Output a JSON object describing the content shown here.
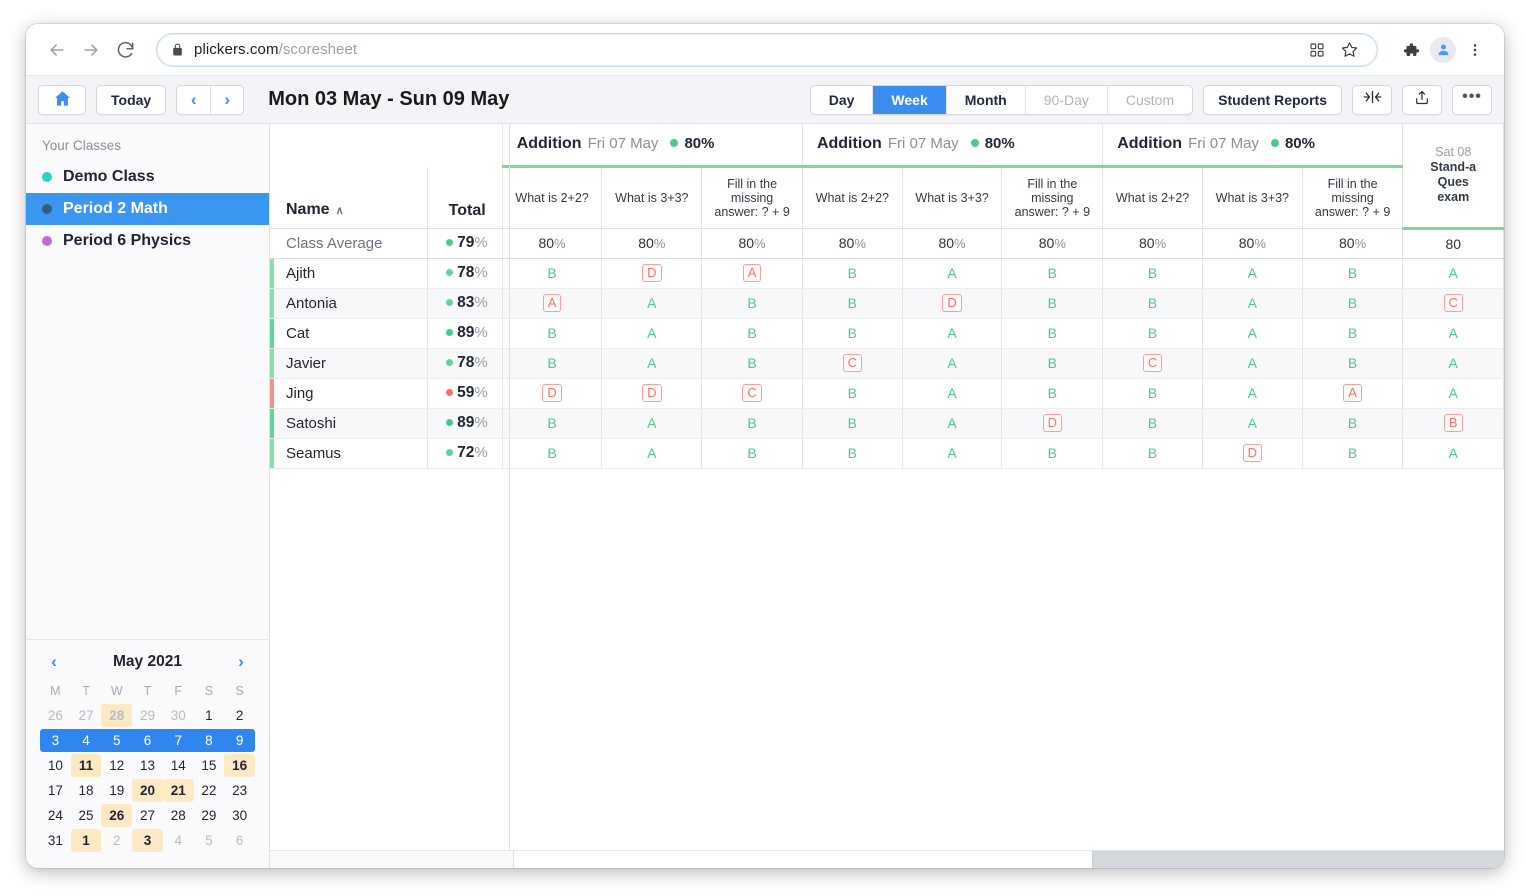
{
  "browser": {
    "url_domain": "plickers.com",
    "url_path": "/scoresheet",
    "back_icon": "back-arrow-icon",
    "forward_icon": "forward-arrow-icon",
    "reload_icon": "reload-icon",
    "lock_icon": "lock-icon",
    "qr_icon": "qr-code-icon",
    "star_icon": "star-icon",
    "extensions_icon": "puzzle-icon",
    "profile_icon": "profile-avatar-icon",
    "menu_icon": "three-dot-menu-icon"
  },
  "toolbar": {
    "home_label": "Home",
    "today_label": "Today",
    "prev_label": "‹",
    "next_label": "›",
    "date_range": "Mon 03 May - Sun 09 May",
    "ranges": [
      {
        "label": "Day",
        "state": "normal"
      },
      {
        "label": "Week",
        "state": "active"
      },
      {
        "label": "Month",
        "state": "normal"
      },
      {
        "label": "90-Day",
        "state": "disabled"
      },
      {
        "label": "Custom",
        "state": "disabled"
      }
    ],
    "student_reports_label": "Student Reports",
    "collapse_icon": "collapse-columns-icon",
    "export_icon": "export-upload-icon",
    "more_label": "•••"
  },
  "sidebar": {
    "title": "Your Classes",
    "items": [
      {
        "label": "Demo Class",
        "color": "#2ecfc3",
        "selected": false
      },
      {
        "label": "Period 2 Math",
        "color": "#2d5f7f",
        "selected": true
      },
      {
        "label": "Period 6 Physics",
        "color": "#bb6fd6",
        "selected": false
      }
    ]
  },
  "calendar": {
    "prev_label": "‹",
    "next_label": "›",
    "month_label": "May 2021",
    "dow": [
      "M",
      "T",
      "W",
      "T",
      "F",
      "S",
      "S"
    ],
    "weeks": [
      {
        "selected": false,
        "days": [
          {
            "n": "26",
            "muted": true,
            "hl": false
          },
          {
            "n": "27",
            "muted": true,
            "hl": false
          },
          {
            "n": "28",
            "muted": true,
            "hl": true
          },
          {
            "n": "29",
            "muted": true,
            "hl": false
          },
          {
            "n": "30",
            "muted": true,
            "hl": false
          },
          {
            "n": "1",
            "muted": false,
            "hl": false
          },
          {
            "n": "2",
            "muted": false,
            "hl": false
          }
        ]
      },
      {
        "selected": true,
        "days": [
          {
            "n": "3",
            "muted": false,
            "hl": false
          },
          {
            "n": "4",
            "muted": false,
            "hl": false
          },
          {
            "n": "5",
            "muted": false,
            "hl": false
          },
          {
            "n": "6",
            "muted": false,
            "hl": false
          },
          {
            "n": "7",
            "muted": false,
            "hl": false
          },
          {
            "n": "8",
            "muted": false,
            "hl": false
          },
          {
            "n": "9",
            "muted": false,
            "hl": false
          }
        ]
      },
      {
        "selected": false,
        "days": [
          {
            "n": "10",
            "muted": false,
            "hl": false
          },
          {
            "n": "11",
            "muted": false,
            "hl": true
          },
          {
            "n": "12",
            "muted": false,
            "hl": false
          },
          {
            "n": "13",
            "muted": false,
            "hl": false
          },
          {
            "n": "14",
            "muted": false,
            "hl": false
          },
          {
            "n": "15",
            "muted": false,
            "hl": false
          },
          {
            "n": "16",
            "muted": false,
            "hl": true
          }
        ]
      },
      {
        "selected": false,
        "days": [
          {
            "n": "17",
            "muted": false,
            "hl": false
          },
          {
            "n": "18",
            "muted": false,
            "hl": false
          },
          {
            "n": "19",
            "muted": false,
            "hl": false
          },
          {
            "n": "20",
            "muted": false,
            "hl": true
          },
          {
            "n": "21",
            "muted": false,
            "hl": true
          },
          {
            "n": "22",
            "muted": false,
            "hl": false
          },
          {
            "n": "23",
            "muted": false,
            "hl": false
          }
        ]
      },
      {
        "selected": false,
        "days": [
          {
            "n": "24",
            "muted": false,
            "hl": false
          },
          {
            "n": "25",
            "muted": false,
            "hl": false
          },
          {
            "n": "26",
            "muted": false,
            "hl": true
          },
          {
            "n": "27",
            "muted": false,
            "hl": false
          },
          {
            "n": "28",
            "muted": false,
            "hl": false
          },
          {
            "n": "29",
            "muted": false,
            "hl": false
          },
          {
            "n": "30",
            "muted": false,
            "hl": false
          }
        ]
      },
      {
        "selected": false,
        "days": [
          {
            "n": "31",
            "muted": false,
            "hl": false
          },
          {
            "n": "1",
            "muted": false,
            "hl": true
          },
          {
            "n": "2",
            "muted": true,
            "hl": false
          },
          {
            "n": "3",
            "muted": false,
            "hl": true
          },
          {
            "n": "4",
            "muted": true,
            "hl": false
          },
          {
            "n": "5",
            "muted": true,
            "hl": false
          },
          {
            "n": "6",
            "muted": true,
            "hl": false
          }
        ]
      }
    ]
  },
  "scoresheet": {
    "name_header": "Name",
    "sort_caret": "∧",
    "total_header": "Total",
    "sets": [
      {
        "name": "Addition",
        "date": "Fri 07 May",
        "pct": "80%",
        "dot_color": "#4cc98a",
        "questions": [
          "What is 2+2?",
          "What is 3+3?",
          "Fill in the missing answer: ? + 9"
        ]
      },
      {
        "name": "Addition",
        "date": "Fri 07 May",
        "pct": "80%",
        "dot_color": "#4cc98a",
        "questions": [
          "What is 2+2?",
          "What is 3+3?",
          "Fill in the missing answer: ? + 9"
        ]
      },
      {
        "name": "Addition",
        "date": "Fri 07 May",
        "pct": "80%",
        "dot_color": "#4cc98a",
        "questions": [
          "What is 2+2?",
          "What is 3+3?",
          "Fill in the missing answer: ? + 9"
        ]
      }
    ],
    "standalone": {
      "date": "Sat 08",
      "line1": "Stand-a",
      "line2": "Ques",
      "line3": "exam"
    },
    "average_row": {
      "name": "Class Average",
      "total": "79",
      "total_symbol": "%",
      "dot_color": "#4cc98a",
      "cells": [
        "80%",
        "80%",
        "80%",
        "80%",
        "80%",
        "80%",
        "80%",
        "80%",
        "80%",
        "80"
      ]
    },
    "rows": [
      {
        "name": "Ajith",
        "total": "78",
        "dot_color": "#5ed39b",
        "flag_color": "#86dfae",
        "answers": [
          {
            "v": "B",
            "correct": true
          },
          {
            "v": "D",
            "correct": false
          },
          {
            "v": "A",
            "correct": false
          },
          {
            "v": "B",
            "correct": true
          },
          {
            "v": "A",
            "correct": true
          },
          {
            "v": "B",
            "correct": true
          },
          {
            "v": "B",
            "correct": true
          },
          {
            "v": "A",
            "correct": true
          },
          {
            "v": "B",
            "correct": true
          },
          {
            "v": "A",
            "correct": true
          }
        ]
      },
      {
        "name": "Antonia",
        "total": "83",
        "dot_color": "#5ed39b",
        "flag_color": "#86dfae",
        "answers": [
          {
            "v": "A",
            "correct": false
          },
          {
            "v": "A",
            "correct": true
          },
          {
            "v": "B",
            "correct": true
          },
          {
            "v": "B",
            "correct": true
          },
          {
            "v": "D",
            "correct": false
          },
          {
            "v": "B",
            "correct": true
          },
          {
            "v": "B",
            "correct": true
          },
          {
            "v": "A",
            "correct": true
          },
          {
            "v": "B",
            "correct": true
          },
          {
            "v": "C",
            "correct": false
          }
        ]
      },
      {
        "name": "Cat",
        "total": "89",
        "dot_color": "#3ecb8d",
        "flag_color": "#5cd79e",
        "answers": [
          {
            "v": "B",
            "correct": true
          },
          {
            "v": "A",
            "correct": true
          },
          {
            "v": "B",
            "correct": true
          },
          {
            "v": "B",
            "correct": true
          },
          {
            "v": "A",
            "correct": true
          },
          {
            "v": "B",
            "correct": true
          },
          {
            "v": "B",
            "correct": true
          },
          {
            "v": "A",
            "correct": true
          },
          {
            "v": "B",
            "correct": true
          },
          {
            "v": "A",
            "correct": true
          }
        ]
      },
      {
        "name": "Javier",
        "total": "78",
        "dot_color": "#5ed39b",
        "flag_color": "#86dfae",
        "answers": [
          {
            "v": "B",
            "correct": true
          },
          {
            "v": "A",
            "correct": true
          },
          {
            "v": "B",
            "correct": true
          },
          {
            "v": "C",
            "correct": false
          },
          {
            "v": "A",
            "correct": true
          },
          {
            "v": "B",
            "correct": true
          },
          {
            "v": "C",
            "correct": false
          },
          {
            "v": "A",
            "correct": true
          },
          {
            "v": "B",
            "correct": true
          },
          {
            "v": "A",
            "correct": true
          }
        ]
      },
      {
        "name": "Jing",
        "total": "59",
        "dot_color": "#f4706c",
        "flag_color": "#f4908c",
        "answers": [
          {
            "v": "D",
            "correct": false
          },
          {
            "v": "D",
            "correct": false
          },
          {
            "v": "C",
            "correct": false
          },
          {
            "v": "B",
            "correct": true
          },
          {
            "v": "A",
            "correct": true
          },
          {
            "v": "B",
            "correct": true
          },
          {
            "v": "B",
            "correct": true
          },
          {
            "v": "A",
            "correct": true
          },
          {
            "v": "A",
            "correct": false
          },
          {
            "v": "A",
            "correct": true
          }
        ]
      },
      {
        "name": "Satoshi",
        "total": "89",
        "dot_color": "#3ecb8d",
        "flag_color": "#5cd79e",
        "answers": [
          {
            "v": "B",
            "correct": true
          },
          {
            "v": "A",
            "correct": true
          },
          {
            "v": "B",
            "correct": true
          },
          {
            "v": "B",
            "correct": true
          },
          {
            "v": "A",
            "correct": true
          },
          {
            "v": "D",
            "correct": false
          },
          {
            "v": "B",
            "correct": true
          },
          {
            "v": "A",
            "correct": true
          },
          {
            "v": "B",
            "correct": true
          },
          {
            "v": "B",
            "correct": false
          }
        ]
      },
      {
        "name": "Seamus",
        "total": "72",
        "dot_color": "#5ed39b",
        "flag_color": "#86dfae",
        "answers": [
          {
            "v": "B",
            "correct": true
          },
          {
            "v": "A",
            "correct": true
          },
          {
            "v": "B",
            "correct": true
          },
          {
            "v": "B",
            "correct": true
          },
          {
            "v": "A",
            "correct": true
          },
          {
            "v": "B",
            "correct": true
          },
          {
            "v": "B",
            "correct": true
          },
          {
            "v": "D",
            "correct": false
          },
          {
            "v": "B",
            "correct": true
          },
          {
            "v": "A",
            "correct": true
          }
        ]
      }
    ]
  },
  "colors": {
    "accent_blue": "#3b8ef0",
    "correct_green": "#4cc98a",
    "wrong_red": "#f4736f",
    "highlight_amber": "#fde9c4"
  }
}
